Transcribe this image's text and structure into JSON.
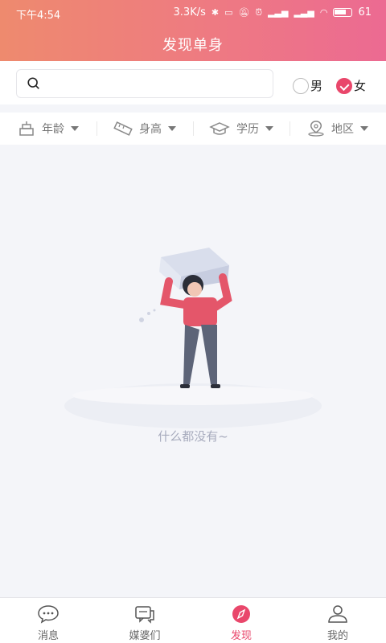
{
  "status_bar": {
    "time": "下午4:54",
    "network_speed": "3.3K/s",
    "battery": "61"
  },
  "header": {
    "title": "发现单身"
  },
  "search": {
    "value": "",
    "placeholder": ""
  },
  "gender": [
    {
      "label": "男",
      "checked": false
    },
    {
      "label": "女",
      "checked": true
    }
  ],
  "filters": [
    {
      "label": "年龄",
      "icon": "cake-icon"
    },
    {
      "label": "身高",
      "icon": "ruler-icon"
    },
    {
      "label": "学历",
      "icon": "graduation-cap-icon"
    },
    {
      "label": "地区",
      "icon": "location-pin-icon"
    }
  ],
  "empty_state": {
    "text": "什么都没有~"
  },
  "tabs": [
    {
      "label": "消息",
      "icon": "chat-bubble-icon",
      "active": false
    },
    {
      "label": "媒婆们",
      "icon": "chat-cards-icon",
      "active": false
    },
    {
      "label": "发现",
      "icon": "compass-icon",
      "active": true
    },
    {
      "label": "我的",
      "icon": "person-icon",
      "active": false
    }
  ],
  "colors": {
    "header_gradient_start": "#ee8a6e",
    "header_gradient_end": "#ec6a92",
    "accent": "#e9476b",
    "background": "#f4f5f9"
  }
}
